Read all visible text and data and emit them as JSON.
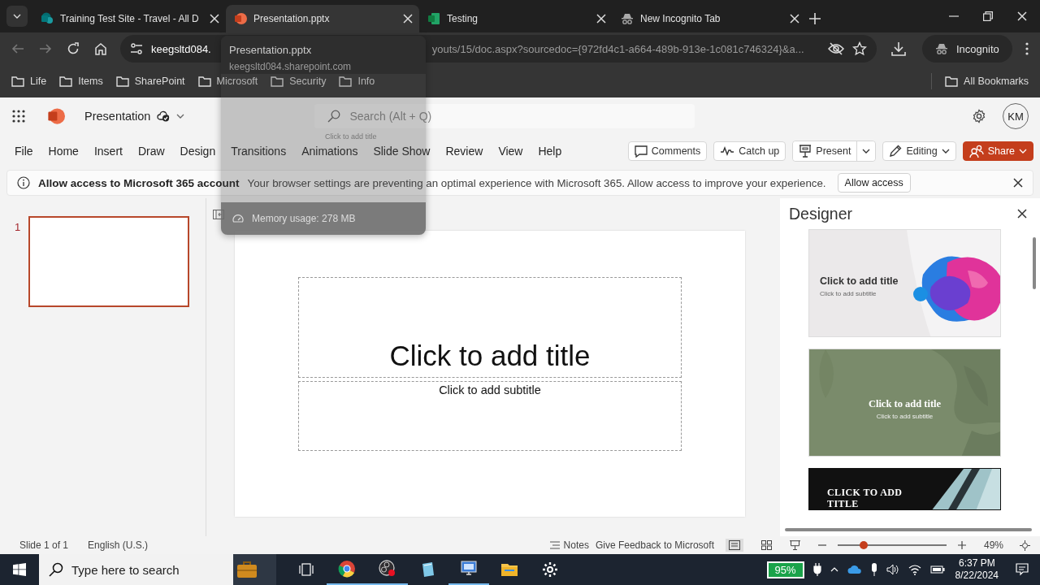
{
  "browser": {
    "tabs": [
      {
        "title": "Training Test Site - Travel - All D",
        "kind": "sharepoint",
        "selected": false
      },
      {
        "title": "Presentation.pptx",
        "kind": "powerpoint",
        "selected": true
      },
      {
        "title": "Testing",
        "kind": "excel",
        "selected": false
      },
      {
        "title": "New Incognito Tab",
        "kind": "incognito",
        "selected": false
      }
    ],
    "address": {
      "host": "keegsltd084.",
      "rest": "youts/15/doc.aspx?sourcedoc={972fd4c1-a664-489b-913e-1c081c746324}&a..."
    },
    "profile": "Incognito",
    "bookmarks": [
      "Life",
      "Items",
      "SharePoint",
      "Microsoft",
      "Security",
      "Info"
    ],
    "all_bookmarks": "All Bookmarks",
    "hover_card": {
      "title": "Presentation.pptx",
      "host": "keegsltd084.sharepoint.com",
      "preview_text": "Click to add title",
      "memory": "Memory usage: 278 MB"
    }
  },
  "app": {
    "doc_title": "Presentation",
    "search_placeholder": "Search (Alt + Q)",
    "avatar": "KM",
    "ribbon_tabs": [
      "File",
      "Home",
      "Insert",
      "Draw",
      "Design",
      "Transitions",
      "Animations",
      "Slide Show",
      "Review",
      "View",
      "Help"
    ],
    "actions": [
      {
        "label": "Comments",
        "kind": "comments"
      },
      {
        "label": "Catch up",
        "kind": "catchup"
      },
      {
        "label": "Present",
        "kind": "present"
      },
      {
        "label": "Editing",
        "kind": "editing"
      },
      {
        "label": "Share",
        "kind": "share"
      }
    ]
  },
  "message_bar": {
    "title": "Allow access to Microsoft 365 account",
    "text": "Your browser settings are preventing an optimal experience with Microsoft 365. Allow access to improve your experience.",
    "button": "Allow access"
  },
  "thumbnails": [
    {
      "number": "1",
      "selected": true
    }
  ],
  "slide": {
    "title": "Click to add title",
    "subtitle": "Click to add subtitle"
  },
  "designer": {
    "title": "Designer",
    "designs": [
      {
        "kind": "fluid",
        "title": "Click to add title",
        "subtitle": "Click to add subtitle"
      },
      {
        "kind": "leaves",
        "title": "Click to add title",
        "subtitle": "Click to add subtitle"
      },
      {
        "kind": "dark",
        "title": "CLICK TO ADD TITLE"
      }
    ]
  },
  "status_bar": {
    "slide": "Slide 1 of 1",
    "language": "English (U.S.)",
    "notes": "Notes",
    "feedback": "Give Feedback to Microsoft",
    "zoom": {
      "level": 0.24
    },
    "zoom_text": "49%"
  },
  "taskbar": {
    "search_placeholder": "Type here to search",
    "battery": "95%",
    "time": "6:37 PM",
    "date": "8/22/2024"
  }
}
